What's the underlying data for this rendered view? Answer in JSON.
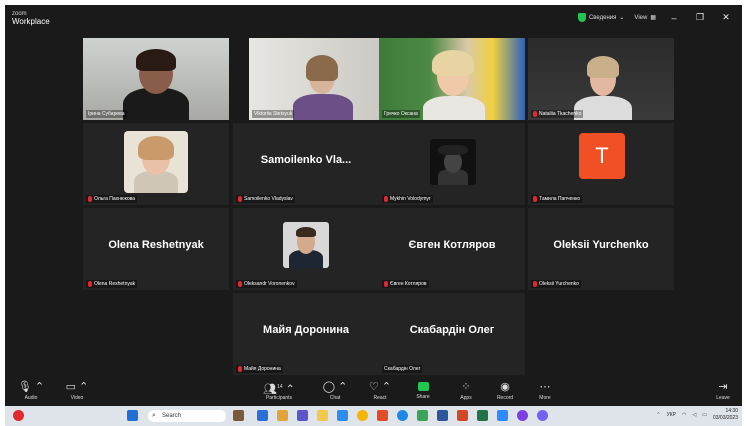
{
  "app": {
    "brand_top": "zoom",
    "brand_bottom": "Workplace"
  },
  "titlebar": {
    "security_label": "Сведения",
    "view_label": "View",
    "minimize": "–",
    "restore": "❐",
    "close": "✕"
  },
  "participants": [
    {
      "name": "Ірина Субарева",
      "mic_muted": false,
      "active": true
    },
    {
      "name": "Viktoriia Stetsyuk",
      "mic_muted": false
    },
    {
      "name": "Гречко Оксана",
      "mic_muted": false
    },
    {
      "name": "Nataliia Tkachenko",
      "mic_muted": true
    },
    {
      "name": "Ольга Пахнюкова",
      "mic_muted": true
    },
    {
      "name": "Samoilenko Vladyslav",
      "display": "Samoilenko Vla...",
      "mic_muted": true
    },
    {
      "name": "Mykhin Volodymyr",
      "mic_muted": true
    },
    {
      "name": "Тамила Папченко",
      "mic_muted": true,
      "initial": "T"
    },
    {
      "name": "Olena Reshetnyak",
      "display": "Olena Reshetnyak",
      "mic_muted": true
    },
    {
      "name": "Oleksandr Voronenkov",
      "mic_muted": true
    },
    {
      "name": "Євген Котляров",
      "display": "Євген Котляров",
      "mic_muted": true
    },
    {
      "name": "Oleksii Yurchenko",
      "display": "Oleksii Yurchenko",
      "mic_muted": true
    },
    {
      "name": "Майя Доронина",
      "display": "Майя Доронина",
      "mic_muted": true
    },
    {
      "name": "Скабардін Олег",
      "display": "Скабардін Олег",
      "mic_muted": false
    }
  ],
  "toolbar": {
    "audio": "Audio",
    "video": "Video",
    "participants": "Participants",
    "participants_count": "14",
    "chat": "Chat",
    "react": "React",
    "share": "Share",
    "apps": "Apps",
    "record": "Record",
    "more": "More",
    "leave": "Leave"
  },
  "taskbar": {
    "search_placeholder": "Search",
    "lang": "УКР",
    "time": "14:30",
    "date": "03/03/2023"
  },
  "colors": {
    "accent_green": "#23c552",
    "mute_red": "#e0282e",
    "avatar_orange": "#f05023"
  }
}
